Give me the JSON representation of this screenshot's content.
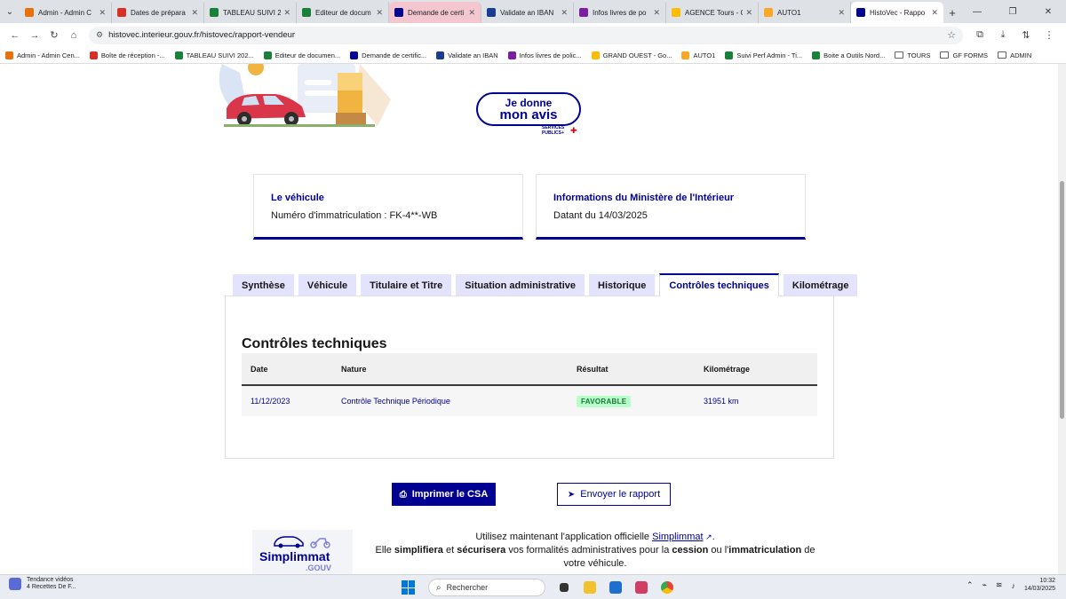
{
  "browser": {
    "tabs": [
      {
        "label": "Admin - Admin C",
        "color": "#e8710a"
      },
      {
        "label": "Dates de prépara",
        "color": "#d93025"
      },
      {
        "label": "TABLEAU SUIVI 20",
        "color": "#188038"
      },
      {
        "label": "Editeur de docum",
        "color": "#188038"
      },
      {
        "label": "Demande de certi",
        "color": "#000091"
      },
      {
        "label": "Validate an IBAN",
        "color": "#1a3d8f"
      },
      {
        "label": "Infos livres de po",
        "color": "#7b1fa2"
      },
      {
        "label": "AGENCE Tours - C",
        "color": "#fbbc04"
      },
      {
        "label": "AUTO1",
        "color": "#f9a825"
      },
      {
        "label": "HistoVec - Rappo",
        "color": "#000091"
      }
    ],
    "url": "histovec.interieur.gouv.fr/histovec/rapport-vendeur",
    "bookmarks": [
      {
        "label": "Admin - Admin Cen...",
        "color": "#e8710a"
      },
      {
        "label": "Boîte de réception -...",
        "color": "#d93025"
      },
      {
        "label": "TABLEAU SUIVI 202...",
        "color": "#188038"
      },
      {
        "label": "Editeur de documen...",
        "color": "#188038"
      },
      {
        "label": "Demande de certific...",
        "color": "#000091"
      },
      {
        "label": "Validate an IBAN",
        "color": "#1a3d8f"
      },
      {
        "label": "Infos livres de polic...",
        "color": "#7b1fa2"
      },
      {
        "label": "GRAND OUEST - Go...",
        "color": "#fbbc04"
      },
      {
        "label": "AUTO1",
        "color": "#f9a825"
      },
      {
        "label": "Suivi Perf Admin - Ti...",
        "color": "#188038"
      },
      {
        "label": "Boite a Outils Nord...",
        "color": "#188038"
      },
      {
        "label": "TOURS",
        "color": "",
        "folder": true
      },
      {
        "label": "GF FORMS",
        "color": "",
        "folder": true
      },
      {
        "label": "ADMIN",
        "color": "",
        "folder": true
      }
    ]
  },
  "feedback": {
    "line1": "Je donne",
    "line2": "mon avis",
    "logo_line1": "SERVICES",
    "logo_line2": "PUBLICS+"
  },
  "cards": {
    "vehicle": {
      "title": "Le véhicule",
      "value": "Numéro d'immatriculation : FK-4**-WB"
    },
    "ministry": {
      "title": "Informations du Ministère de l'Intérieur",
      "value": "Datant du 14/03/2025"
    }
  },
  "report_tabs": [
    "Synthèse",
    "Véhicule",
    "Titulaire et Titre",
    "Situation administrative",
    "Historique",
    "Contrôles techniques",
    "Kilométrage"
  ],
  "active_tab": "Contrôles techniques",
  "section": {
    "title": "Contrôles techniques",
    "columns": [
      "Date",
      "Nature",
      "Résultat",
      "Kilométrage"
    ],
    "rows": [
      {
        "date": "11/12/2023",
        "nature": "Contrôle Technique Périodique",
        "result": "FAVORABLE",
        "km": "31951 km"
      }
    ]
  },
  "actions": {
    "print": "Imprimer le CSA",
    "send": "Envoyer le rapport"
  },
  "promo": {
    "logo_title": "Simplimmat",
    "logo_sub": ".GOUV",
    "t_intro": "Utilisez maintenant l'application officielle",
    "t_link": "Simplimmat",
    "t_dot": ".",
    "t_elle": "Elle",
    "t_simplifiera": "simplifiera",
    "t_et": "et",
    "t_securisera": "sécurisera",
    "t_formalites": "vos formalités administratives pour la",
    "t_cession": "cession",
    "t_ou": "ou l'",
    "t_immat": "immatriculation",
    "t_de": "de",
    "t_end": "votre véhicule."
  },
  "taskbar": {
    "widget_line1": "Tendance vidéos",
    "widget_line2": "4 Recettes De F...",
    "search_placeholder": "Rechercher",
    "time": "10:32",
    "date": "14/03/2025"
  }
}
